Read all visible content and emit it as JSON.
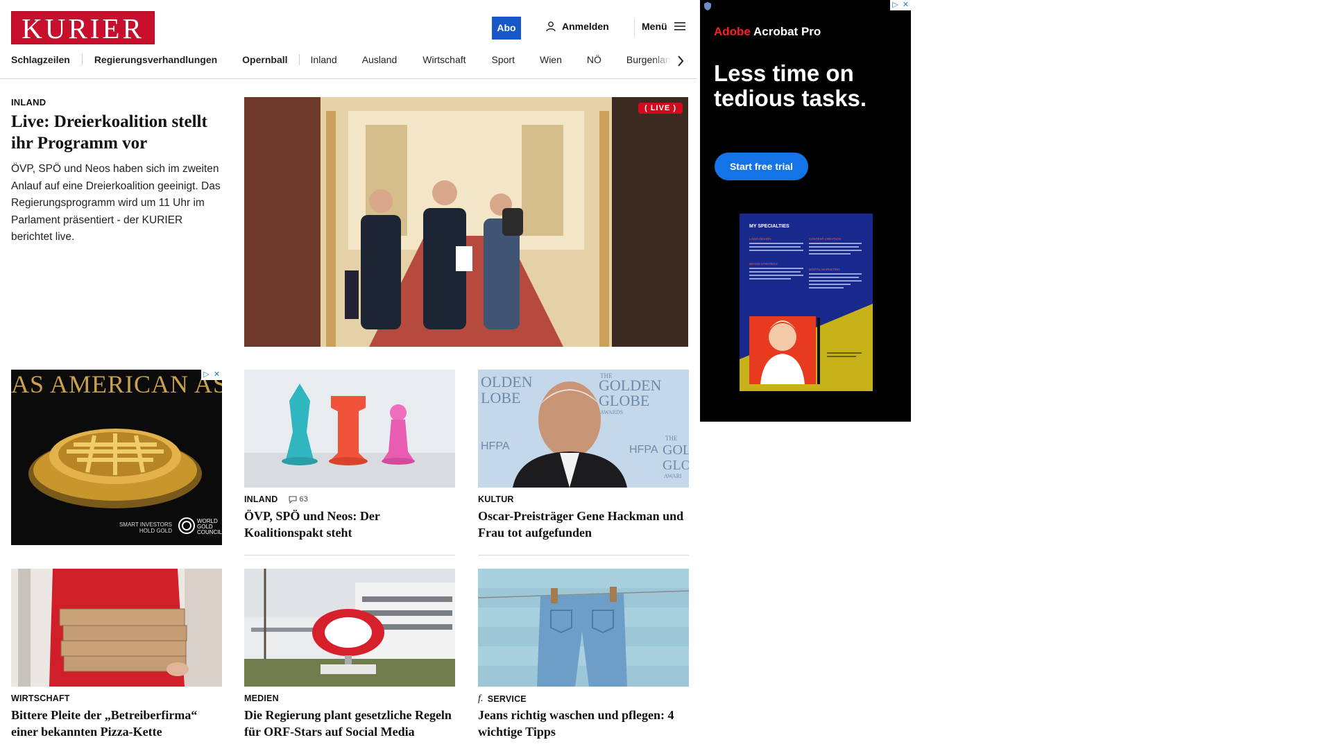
{
  "header": {
    "logo": "KURIER",
    "abo_label": "Abo",
    "login_label": "Anmelden",
    "menu_label": "Menü"
  },
  "nav": {
    "items": [
      "Schlagzeilen",
      "Regierungsverhandlungen",
      "Opernball",
      "Inland",
      "Ausland",
      "Wirtschaft",
      "Sport",
      "Wien",
      "NÖ",
      "Burgenland"
    ]
  },
  "lead": {
    "category": "INLAND",
    "title": "Live: Dreierkoalition stellt ihr Programm vor",
    "teaser": "ÖVP, SPÖ und Neos haben sich im zweiten Anlauf auf eine Dreierkoalition geeinigt. Das Regierungsprogramm wird um 11 Uhr im Parlament präsentiert - der KURIER berichtet live.",
    "badge": "LIVE"
  },
  "cards": [
    {
      "category": "INLAND",
      "comments": "63",
      "title": "ÖVP, SPÖ und Neos: Der Koalitionspakt steht"
    },
    {
      "category": "KULTUR",
      "title": "Oscar-Preisträger Gene Hackman und Frau tot aufgefunden"
    },
    {
      "category": "WIRTSCHAFT",
      "title": "Bittere Pleite der „Betreiberfirma“ einer bekannten Pizza-Kette"
    },
    {
      "category": "MEDIEN",
      "title": "Die Regierung plant gesetzliche Regeln für ORF-Stars auf Social Media"
    },
    {
      "category": "SERVICE",
      "title": "Jeans richtig waschen und pflegen: 4 wichtige Tipps"
    }
  ],
  "image_text": {
    "golden_globe": [
      "OLDEN",
      "LOBE",
      "THE",
      "GOLDEN",
      "GLOBE",
      "AWARDS",
      "HFPA",
      "HFPA",
      "THE",
      "GOL",
      "GLO",
      "AWARI"
    ]
  },
  "ads": {
    "left": {
      "headline": "AS AMERICAN AS",
      "tagline": "SMART INVESTORS HOLD GOLD",
      "logo_text": "WORLD GOLD COUNCIL"
    },
    "right": {
      "brand_red": "Adobe",
      "brand_white": "Acrobat Pro",
      "headline": "Less time on tedious tasks.",
      "cta": "Start free trial",
      "doc_title": "MY SPECIALTIES",
      "doc_sections": [
        "LOGO DESIGN",
        "CONTENT CREATION",
        "BRAND STRATEGY",
        "DIGITAL MARKETING"
      ]
    }
  },
  "colors": {
    "brand_red": "#c8102e",
    "abo_blue": "#1857c7",
    "live_red": "#d20a1e",
    "adobe_blue": "#1473e6"
  }
}
